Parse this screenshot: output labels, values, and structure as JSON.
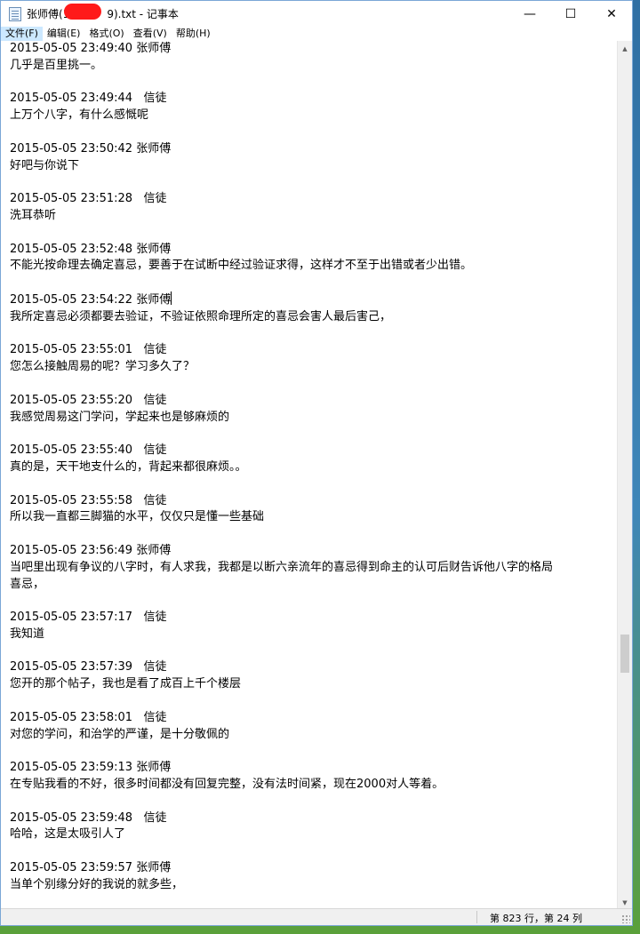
{
  "window": {
    "title_prefix": "张师傅(1",
    "title_suffix": "9).txt - 记事本"
  },
  "menu": [
    "文件(F)",
    "编辑(E)",
    "格式(O)",
    "查看(V)",
    "帮助(H)"
  ],
  "lines": [
    "2015-05-05 23:49:40 张师傅",
    "几乎是百里挑一。",
    "",
    "2015-05-05 23:49:44   信徒",
    "上万个八字，有什么感慨呢",
    "",
    "2015-05-05 23:50:42 张师傅",
    "好吧与你说下",
    "",
    "2015-05-05 23:51:28   信徒",
    "洗耳恭听",
    "",
    "2015-05-05 23:52:48 张师傅",
    "不能光按命理去确定喜忌，要善于在试断中经过验证求得，这样才不至于出错或者少出错。",
    "",
    "2015-05-05 23:54:22 张师傅",
    "我所定喜忌必须都要去验证，不验证依照命理所定的喜忌会害人最后害己，",
    "",
    "2015-05-05 23:55:01   信徒",
    "您怎么接触周易的呢？学习多久了？",
    "",
    "2015-05-05 23:55:20   信徒",
    "我感觉周易这门学问，学起来也是够麻烦的",
    "",
    "2015-05-05 23:55:40   信徒",
    "真的是，天干地支什么的，背起来都很麻烦。。",
    "",
    "2015-05-05 23:55:58   信徒",
    "所以我一直都三脚猫的水平，仅仅只是懂一些基础",
    "",
    "2015-05-05 23:56:49 张师傅",
    "当吧里出现有争议的八字时，有人求我，我都是以断六亲流年的喜忌得到命主的认可后财告诉他八字的格局",
    "喜忌，",
    "",
    "2015-05-05 23:57:17   信徒",
    "我知道",
    "",
    "2015-05-05 23:57:39   信徒",
    "您开的那个帖子，我也是看了成百上千个楼层",
    "",
    "2015-05-05 23:58:01   信徒",
    "对您的学问，和治学的严谨，是十分敬佩的",
    "",
    "2015-05-05 23:59:13 张师傅",
    "在专贴我看的不好，很多时间都没有回复完整，没有法时间紧，现在2000对人等着。",
    "",
    "2015-05-05 23:59:48   信徒",
    "哈哈，这是太吸引人了",
    "",
    "2015-05-05 23:59:57 张师傅",
    "当单个别缘分好的我说的就多些，"
  ],
  "status": {
    "position": "第 823 行，第 24 列"
  },
  "icons": {
    "minimize": "—",
    "maximize": "☐",
    "close": "✕",
    "scroll_up": "▲",
    "scroll_down": "▼"
  },
  "scroll": {
    "thumb_fraction_start": 0.69,
    "thumb_fraction_size": 0.045
  }
}
